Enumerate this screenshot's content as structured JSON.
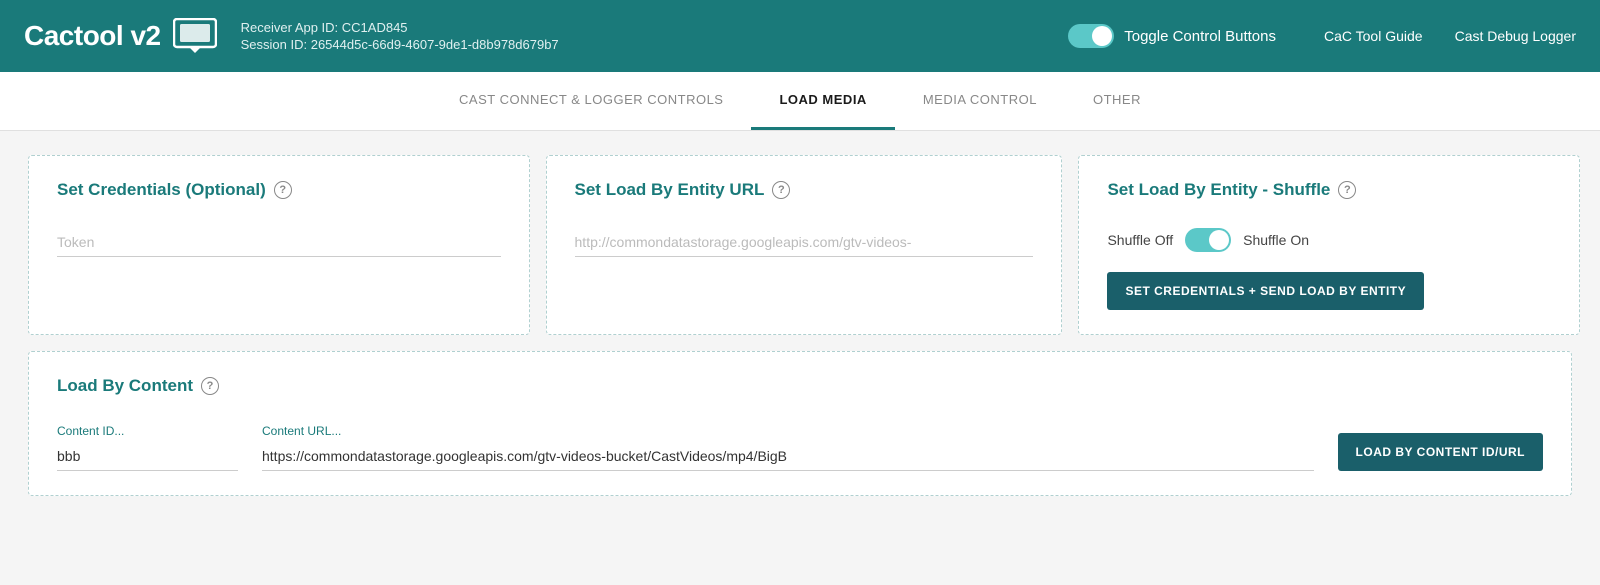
{
  "header": {
    "logo_text": "Cactool",
    "logo_version": " v2",
    "receiver_app_label": "Receiver App ID: CC1AD845",
    "session_id_label": "Session ID: 26544d5c-66d9-4607-9de1-d8b978d679b7",
    "toggle_label": "Toggle Control Buttons",
    "toggle_on": true,
    "nav_links": [
      {
        "id": "cac-tool-guide",
        "label": "CaC Tool Guide"
      },
      {
        "id": "cast-debug-logger",
        "label": "Cast Debug Logger"
      }
    ]
  },
  "tabs": [
    {
      "id": "cast-connect",
      "label": "CAST CONNECT & LOGGER CONTROLS",
      "active": false
    },
    {
      "id": "load-media",
      "label": "LOAD MEDIA",
      "active": true
    },
    {
      "id": "media-control",
      "label": "MEDIA CONTROL",
      "active": false
    },
    {
      "id": "other",
      "label": "OTHER",
      "active": false
    }
  ],
  "cards": {
    "credentials": {
      "title": "Set Credentials (Optional)",
      "token_placeholder": "Token"
    },
    "entity_url": {
      "title": "Set Load By Entity URL",
      "url_placeholder": "http://commondatastorage.googleapis.com/gtv-videos-"
    },
    "shuffle": {
      "title": "Set Load By Entity - Shuffle",
      "shuffle_off_label": "Shuffle Off",
      "shuffle_on_label": "Shuffle On",
      "button_label": "SET CREDENTIALS + SEND LOAD BY ENTITY",
      "toggle_on": true
    },
    "load_content": {
      "title": "Load By Content",
      "content_id_label": "Content ID...",
      "content_id_value": "bbb",
      "content_url_label": "Content URL...",
      "content_url_value": "https://commondatastorage.googleapis.com/gtv-videos-bucket/CastVideos/mp4/BigB",
      "button_label": "LOAD BY CONTENT ID/URL"
    }
  }
}
